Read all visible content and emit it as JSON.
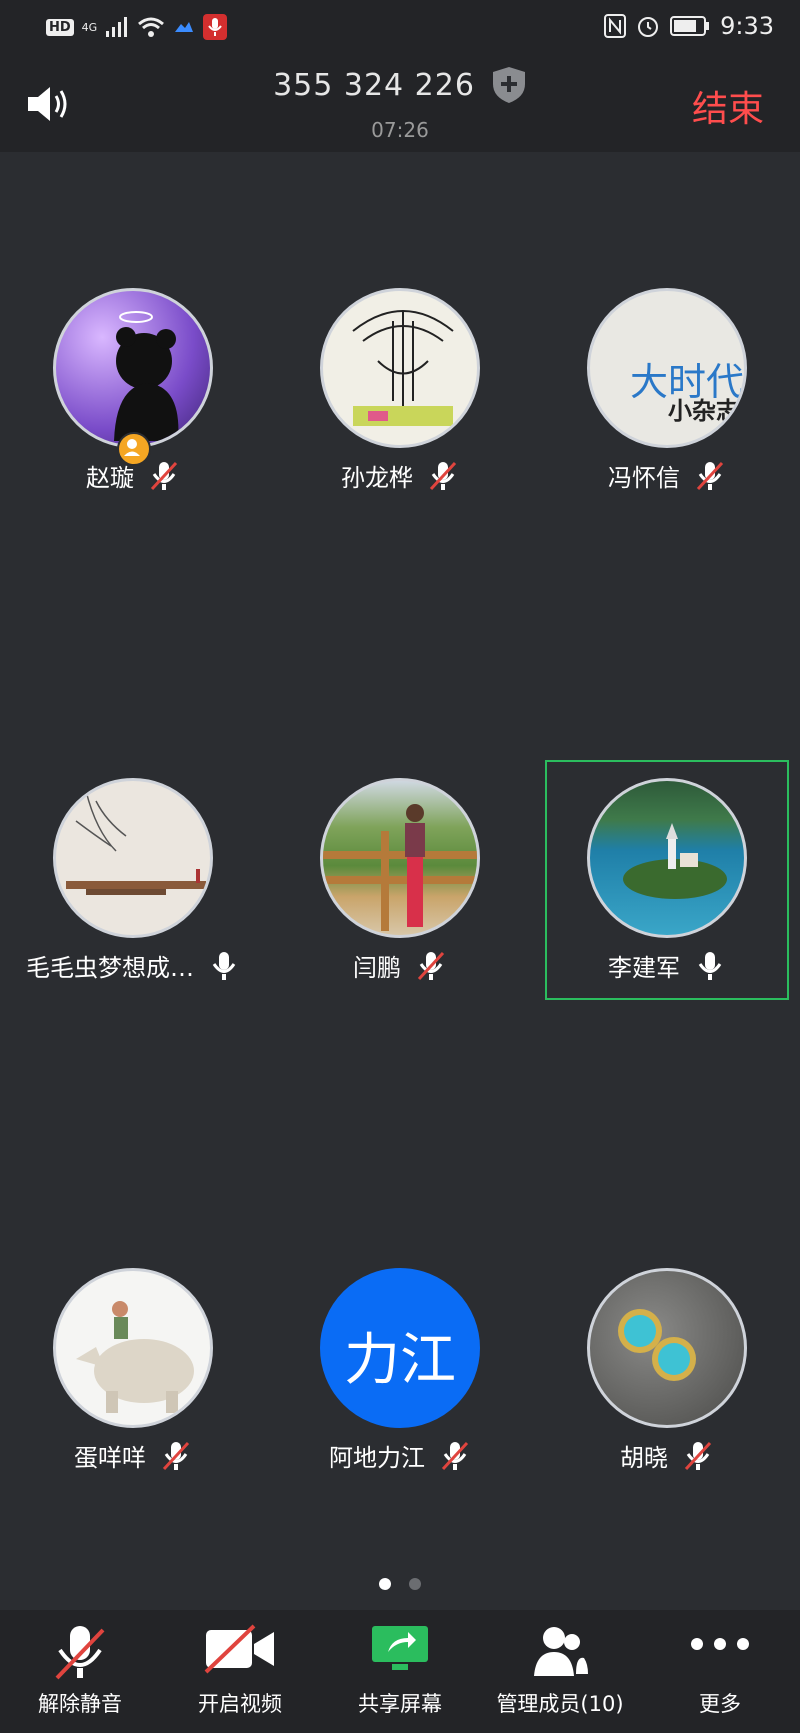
{
  "status_bar": {
    "hd": "HD",
    "network": "4G",
    "time": "9:33"
  },
  "header": {
    "meeting_id": "355 324 226",
    "timer": "07:26",
    "end_label": "结束"
  },
  "participants": [
    {
      "name": "赵璇",
      "mic": "muted",
      "avatar": "purple-silhouette",
      "host": true
    },
    {
      "name": "孙龙桦",
      "mic": "muted",
      "avatar": "sketch-drawing"
    },
    {
      "name": "冯怀信",
      "mic": "muted",
      "avatar": "magazine-cover",
      "avatar_text": [
        "大时代",
        "小杂志"
      ]
    },
    {
      "name": "毛毛虫梦想成…",
      "mic": "on",
      "avatar": "bridge-landscape"
    },
    {
      "name": "闫鹏",
      "mic": "muted",
      "avatar": "person-fence"
    },
    {
      "name": "李建军",
      "mic": "on",
      "avatar": "lake-island",
      "selected": true
    },
    {
      "name": "蛋咩咩",
      "mic": "muted",
      "avatar": "rhino-figurine"
    },
    {
      "name": "阿地力江",
      "mic": "muted",
      "avatar": "text",
      "avatar_text": "力江",
      "avatar_color": "#0a6cf5"
    },
    {
      "name": "胡晓",
      "mic": "muted",
      "avatar": "turquoise-earrings"
    }
  ],
  "pager": {
    "pages": 2,
    "current": 1
  },
  "toolbar": {
    "unmute": "解除静音",
    "video": "开启视频",
    "share": "共享屏幕",
    "members": "管理成员(10)",
    "more": "更多"
  },
  "colors": {
    "accent_green": "#2bbd5e",
    "end_red": "#ff4d4d",
    "mute_red": "#e0443e",
    "text_avatar_blue": "#0a6cf5"
  }
}
